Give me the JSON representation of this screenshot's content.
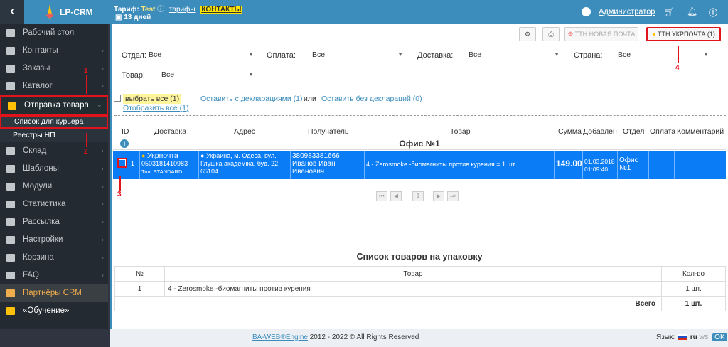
{
  "header": {
    "back_icon": "chevron-left-icon",
    "logo_text": "LP-CRM",
    "tariff_label": "Тариф:",
    "tariff_plan": "Test",
    "tariffs_link": "тарифы",
    "contacts_link": "КОНТАКТЫ",
    "days_left": "13 дней",
    "user_name": "Администратор",
    "icons": [
      "user-icon",
      "cart-icon",
      "bell-icon",
      "info-icon"
    ]
  },
  "sidebar": {
    "items": [
      {
        "label": "Рабочий стол",
        "icon": "desktop-icon"
      },
      {
        "label": "Контакты",
        "icon": "users-icon"
      },
      {
        "label": "Заказы",
        "icon": "money-icon"
      },
      {
        "label": "Каталог",
        "icon": "tag-icon"
      },
      {
        "label": "Отправка товара",
        "icon": "truck-icon"
      },
      {
        "label": "Склад",
        "icon": "box-icon"
      },
      {
        "label": "Шаблоны",
        "icon": "file-icon"
      },
      {
        "label": "Модули",
        "icon": "puzzle-icon"
      },
      {
        "label": "Статистика",
        "icon": "chart-icon"
      },
      {
        "label": "Рассылка",
        "icon": "megaphone-icon"
      },
      {
        "label": "Настройки",
        "icon": "gear-icon"
      },
      {
        "label": "Корзина",
        "icon": "trash-icon"
      },
      {
        "label": "FAQ",
        "icon": "info-icon"
      },
      {
        "label": "Партнёры CRM",
        "icon": "handshake-icon"
      },
      {
        "label": "«Обучение»",
        "icon": "video-icon"
      }
    ],
    "subitems": [
      "Список для курьера",
      "Реестры НП"
    ]
  },
  "toolbar": {
    "ttn_new": "ТТН НОВАЯ ПОЧТА",
    "ttn_ukr": "ТТН УКРПОЧТА (1)"
  },
  "filters": {
    "otdel_label": "Отдел:",
    "otdel_value": "Все",
    "oplata_label": "Оплата:",
    "oplata_value": "Все",
    "dostavka_label": "Доставка:",
    "dostavka_value": "Все",
    "strana_label": "Страна:",
    "strana_value": "Все",
    "tovar_label": "Товар:",
    "tovar_value": "Все"
  },
  "selection": {
    "select_all": "выбрать все (1)",
    "leave_with": "Оставить с декларациями (1)",
    "or": "или",
    "leave_without": "Оставить без деклараций (0)",
    "show_all": "Отобразить все (1)"
  },
  "table": {
    "headers": [
      "ID",
      "Доставка",
      "Адрес",
      "Получатель",
      "Товар",
      "Сумма",
      "Добавлен",
      "Отдел",
      "Оплата",
      "Комментарий"
    ],
    "group_title": "Офис №1",
    "row": {
      "id": "1",
      "delivery": "Укрпочта",
      "delivery_ttn": "0503181410983",
      "delivery_type": "Тип: STANDARD",
      "address": "Украина, м. Одеса, вул. Глушка академіка, буд. 22, 65104",
      "recipient_phone": "380983381666",
      "recipient_name": "Иванов Иван Иванович",
      "product": "4 - Zerosmoke -биомагниты против курения = 1 шт.",
      "sum": "149.00",
      "added": "01.03.2018 01:09:40",
      "office": "Офис №1"
    },
    "page": "1"
  },
  "annotations": [
    "1",
    "2",
    "3",
    "4"
  ],
  "packing": {
    "title": "Список товаров на упаковку",
    "headers": [
      "№",
      "Товар",
      "Кол-во"
    ],
    "rows": [
      {
        "n": "1",
        "product": "4 - Zerosmoke -биомагниты против курения",
        "qty": "1 шт."
      }
    ],
    "total_label": "Всего",
    "total_value": "1 шт."
  },
  "footer": {
    "brand_link": "BA-WEB®Engine",
    "copyright": " 2012 - 2022 © All Rights Reserved",
    "lang_label": "Язык:",
    "lang_value": "ru",
    "ws": "WS",
    "ok": "OK"
  }
}
